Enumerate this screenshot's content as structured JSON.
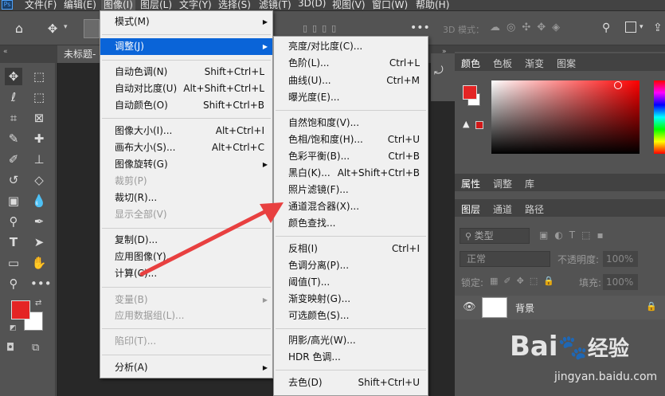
{
  "app": {
    "logo": "Ps"
  },
  "menubar": {
    "items": [
      "文件(F)",
      "编辑(E)",
      "图像(I)",
      "图层(L)",
      "文字(Y)",
      "选择(S)",
      "滤镜(T)",
      "3D(D)",
      "视图(V)",
      "窗口(W)",
      "帮助(H)"
    ],
    "active_index": 2
  },
  "options": {
    "mode3d": "3D 模式："
  },
  "doc_tab": {
    "label": "未标题-"
  },
  "image_menu": {
    "items": [
      {
        "label": "模式(M)",
        "shortcut": "",
        "sub": true,
        "disabled": false
      },
      {
        "label": "调整(J)",
        "shortcut": "",
        "sub": true,
        "disabled": false,
        "highlight": true
      },
      {
        "label": "自动色调(N)",
        "shortcut": "Shift+Ctrl+L"
      },
      {
        "label": "自动对比度(U)",
        "shortcut": "Alt+Shift+Ctrl+L"
      },
      {
        "label": "自动颜色(O)",
        "shortcut": "Shift+Ctrl+B"
      },
      {
        "label": "图像大小(I)...",
        "shortcut": "Alt+Ctrl+I"
      },
      {
        "label": "画布大小(S)...",
        "shortcut": "Alt+Ctrl+C"
      },
      {
        "label": "图像旋转(G)",
        "shortcut": "",
        "sub": true
      },
      {
        "label": "裁剪(P)",
        "shortcut": "",
        "disabled": true
      },
      {
        "label": "裁切(R)...",
        "shortcut": ""
      },
      {
        "label": "显示全部(V)",
        "shortcut": "",
        "disabled": true
      },
      {
        "label": "复制(D)...",
        "shortcut": ""
      },
      {
        "label": "应用图像(Y)...",
        "shortcut": ""
      },
      {
        "label": "计算(C)...",
        "shortcut": ""
      },
      {
        "label": "变量(B)",
        "shortcut": "",
        "sub": true,
        "disabled": true
      },
      {
        "label": "应用数据组(L)...",
        "shortcut": "",
        "disabled": true
      },
      {
        "label": "陷印(T)...",
        "shortcut": "",
        "disabled": true
      },
      {
        "label": "分析(A)",
        "shortcut": "",
        "sub": true
      }
    ]
  },
  "adjust_menu": {
    "items": [
      {
        "label": "亮度/对比度(C)...",
        "shortcut": ""
      },
      {
        "label": "色阶(L)...",
        "shortcut": "Ctrl+L"
      },
      {
        "label": "曲线(U)...",
        "shortcut": "Ctrl+M"
      },
      {
        "label": "曝光度(E)...",
        "shortcut": ""
      },
      {
        "label": "自然饱和度(V)...",
        "shortcut": ""
      },
      {
        "label": "色相/饱和度(H)...",
        "shortcut": "Ctrl+U"
      },
      {
        "label": "色彩平衡(B)...",
        "shortcut": "Ctrl+B"
      },
      {
        "label": "黑白(K)...",
        "shortcut": "Alt+Shift+Ctrl+B"
      },
      {
        "label": "照片滤镜(F)...",
        "shortcut": ""
      },
      {
        "label": "通道混合器(X)...",
        "shortcut": ""
      },
      {
        "label": "颜色查找...",
        "shortcut": ""
      },
      {
        "label": "反相(I)",
        "shortcut": "Ctrl+I"
      },
      {
        "label": "色调分离(P)...",
        "shortcut": ""
      },
      {
        "label": "阈值(T)...",
        "shortcut": ""
      },
      {
        "label": "渐变映射(G)...",
        "shortcut": ""
      },
      {
        "label": "可选颜色(S)...",
        "shortcut": ""
      },
      {
        "label": "阴影/高光(W)...",
        "shortcut": ""
      },
      {
        "label": "HDR 色调...",
        "shortcut": ""
      },
      {
        "label": "去色(D)",
        "shortcut": "Shift+Ctrl+U"
      }
    ]
  },
  "color_panel": {
    "tabs": [
      "颜色",
      "色板",
      "渐变",
      "图案"
    ],
    "fg": "#e02020",
    "bg": "#ffffff"
  },
  "props_panel": {
    "tabs": [
      "属性",
      "调整",
      "库"
    ]
  },
  "layers_panel": {
    "tabs": [
      "图层",
      "通道",
      "路径"
    ],
    "filter": "类型",
    "blend": "正常",
    "opacity_label": "不透明度:",
    "opacity": "100%",
    "lock_label": "锁定:",
    "fill_label": "填充:",
    "fill": "100%",
    "layer_name": "背景"
  },
  "watermark": {
    "brand": "Bai",
    "brand2": "经验",
    "url": "jingyan.baidu.com"
  },
  "colors": {
    "highlight": "#0a64d8",
    "accent_red": "#e42424"
  }
}
